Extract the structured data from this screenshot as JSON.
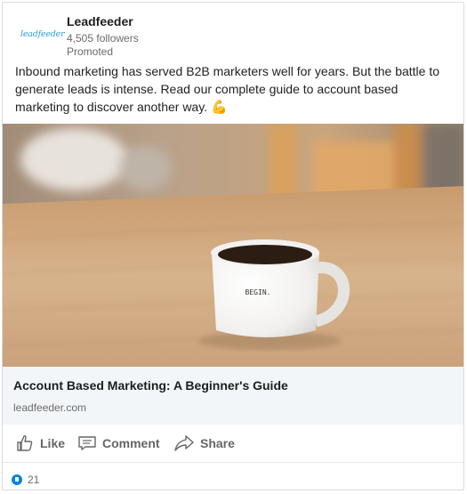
{
  "post": {
    "company_name": "Leadfeeder",
    "logo_text": "leadfeeder",
    "followers": "4,505 followers",
    "promoted": "Promoted",
    "body_text": "Inbound marketing has served B2B marketers well for years. But the battle to generate leads is intense. Read our complete guide to account based marketing to discover another way.",
    "body_emoji": "💪",
    "image": {
      "mug_text": "BEGIN."
    },
    "link": {
      "title": "Account Based Marketing: A Beginner's Guide",
      "domain": "leadfeeder.com"
    },
    "actions": {
      "like_label": "Like",
      "comment_label": "Comment",
      "share_label": "Share"
    },
    "social": {
      "like_count": "21"
    }
  },
  "icons": {
    "logo": "leadfeeder-logo",
    "like": "thumbs-up-icon",
    "comment": "comment-icon",
    "share": "share-arrow-icon",
    "reaction": "like-reaction-icon"
  },
  "colors": {
    "accent": "#0a84d8",
    "logo": "#2a9ed8",
    "muted_text": "#6b6b6b",
    "link_background": "#f3f6f8"
  }
}
